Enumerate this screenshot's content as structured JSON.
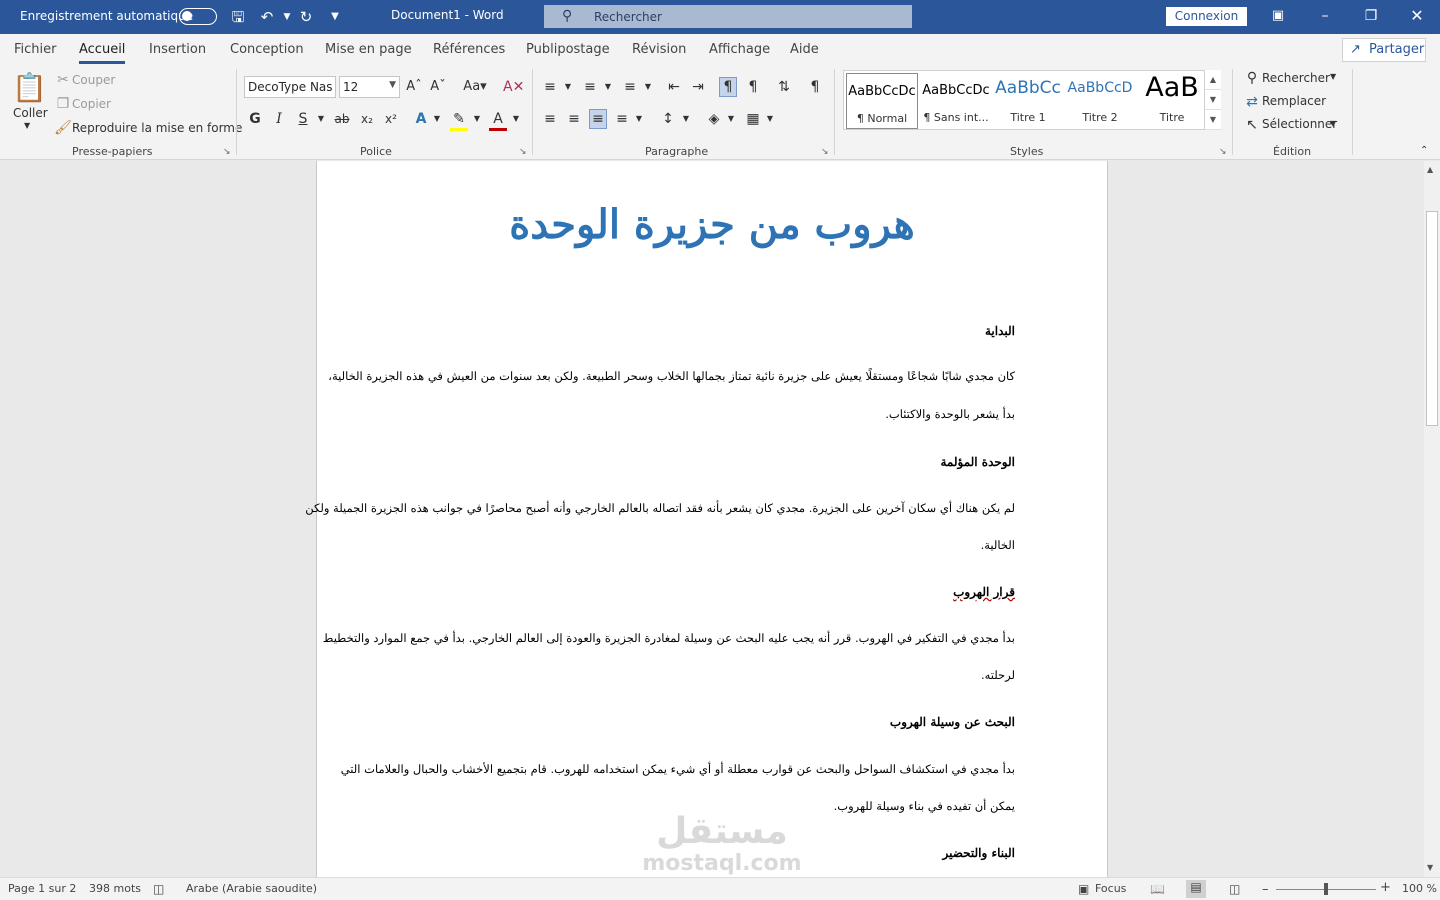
{
  "titlebar": {
    "autosave_label": "Enregistrement automatique",
    "doc_title": "Document1  -  Word",
    "search_placeholder": "Rechercher",
    "signin_label": "Connexion"
  },
  "tabs": [
    "Fichier",
    "Accueil",
    "Insertion",
    "Conception",
    "Mise en page",
    "Références",
    "Publipostage",
    "Révision",
    "Affichage",
    "Aide"
  ],
  "share_label": "Partager",
  "clipboard": {
    "paste_label": "Coller",
    "cut_label": "Couper",
    "copy_label": "Copier",
    "format_painter_label": "Reproduire la mise en forme",
    "group_label": "Presse-papiers"
  },
  "font": {
    "font_name": "DecoType Nas",
    "font_size": "12",
    "group_label": "Police"
  },
  "paragraph": {
    "group_label": "Paragraphe"
  },
  "styles": {
    "items": [
      {
        "sample": "AaBbCcDc",
        "name": "¶ Normal"
      },
      {
        "sample": "AaBbCcDc",
        "name": "¶ Sans int..."
      },
      {
        "sample": "AaBbCc",
        "name": "Titre 1"
      },
      {
        "sample": "AaBbCcD",
        "name": "Titre 2"
      },
      {
        "sample": "AaB",
        "name": "Titre"
      }
    ],
    "group_label": "Styles"
  },
  "editing": {
    "find_label": "Rechercher",
    "replace_label": "Remplacer",
    "select_label": "Sélectionner",
    "group_label": "Édition"
  },
  "document": {
    "title": "هروب من جزيرة الوحدة",
    "sections": [
      {
        "heading": "البداية",
        "lines": [
          "كان مجدي شابًا شجاعًا ومستقلًا يعيش على جزيرة نائية تمتاز بجمالها الخلاب وسحر الطبيعة. ولكن بعد سنوات من العيش في هذه الجزيرة الخالية،",
          "بدأ يشعر بالوحدة والاكتئاب."
        ]
      },
      {
        "heading": "الوحدة المؤلمة",
        "lines": [
          "لم يكن هناك أي سكان آخرين على الجزيرة. مجدي كان يشعر بأنه فقد اتصاله بالعالم الخارجي وأنه أصبح محاصرًا في جوانب هذه الجزيرة الجميلة ولكن",
          "الخالية."
        ]
      },
      {
        "heading": "قرار الهروب",
        "lines": [
          "بدأ مجدي في التفكير في الهروب. قرر أنه يجب عليه البحث عن وسيلة لمغادرة الجزيرة والعودة إلى العالم الخارجي. بدأ في جمع الموارد والتخطيط",
          "لرحلته."
        ]
      },
      {
        "heading": "البحث عن وسيلة الهروب",
        "lines": [
          "بدأ مجدي في استكشاف السواحل والبحث عن قوارب معطلة أو أي شيء يمكن استخدامه للهروب. قام بتجميع الأخشاب والحبال والعلامات التي",
          "يمكن أن تفيده في بناء وسيلة للهروب."
        ]
      },
      {
        "heading": "البناء والتحضير",
        "lines": []
      }
    ]
  },
  "watermark": {
    "arabic": "مستقل",
    "latin": "mostaql.com"
  },
  "status": {
    "page": "Page 1 sur 2",
    "words": "398 mots",
    "language": "Arabe (Arabie saoudite)",
    "focus": "Focus",
    "zoom": "100 %"
  }
}
